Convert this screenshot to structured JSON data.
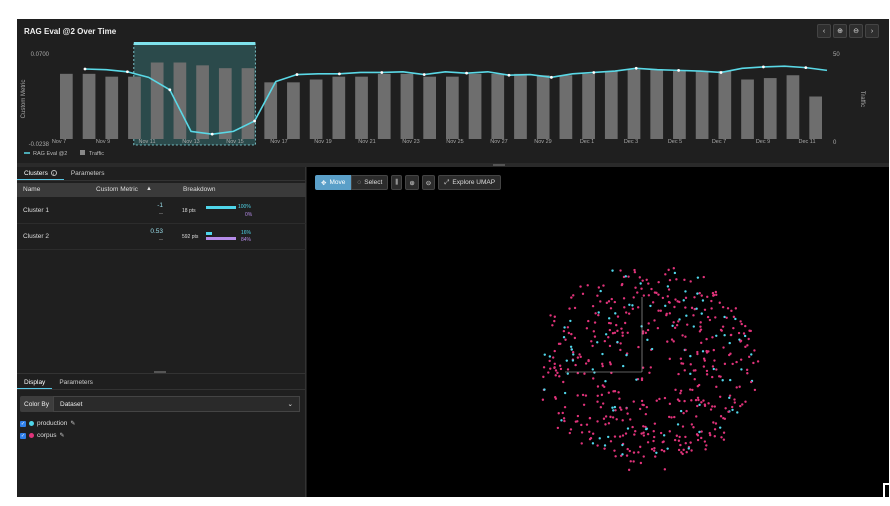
{
  "header": {
    "title": "RAG Eval @2 Over Time",
    "nav": [
      "‹",
      "⊕",
      "⊖",
      "›"
    ]
  },
  "chart_data": {
    "type": "bar",
    "title": "RAG Eval @2 Over Time",
    "ylabel": "Custom Metric",
    "y2label": "Traffic",
    "ytick_labels": [
      "0.0700",
      "-0.0238"
    ],
    "y2tick_labels": [
      "50",
      "0"
    ],
    "x_tick_labels": [
      "Nov 7",
      "Nov 9",
      "Nov 11",
      "Nov 13",
      "Nov 15",
      "Nov 17",
      "Nov 19",
      "Nov 21",
      "Nov 23",
      "Nov 25",
      "Nov 27",
      "Nov 29",
      "Dec 1",
      "Dec 3",
      "Dec 5",
      "Dec 7",
      "Dec 9",
      "Dec 11"
    ],
    "series": [
      {
        "name": "RAG Eval @2",
        "type": "line",
        "color": "#5ad8e6",
        "values": [
          0.07,
          0.069,
          0.066,
          0.058,
          0.04,
          -0.02,
          -0.024,
          -0.02,
          -0.005,
          0.052,
          0.062,
          0.063,
          0.063,
          0.065,
          0.065,
          0.066,
          0.062,
          0.066,
          0.064,
          0.066,
          0.061,
          0.062,
          0.058,
          0.063,
          0.065,
          0.067,
          0.071,
          0.069,
          0.068,
          0.067,
          0.065,
          0.071,
          0.073,
          0.074,
          0.072,
          0.068
        ]
      },
      {
        "name": "Traffic",
        "type": "bar",
        "color": "#6e6e6e",
        "values": [
          46,
          46,
          44,
          44,
          54,
          54,
          52,
          50,
          50,
          40,
          40,
          42,
          44,
          44,
          46,
          46,
          44,
          44,
          46,
          46,
          46,
          45,
          45,
          46,
          48,
          49,
          49,
          48,
          48,
          48,
          42,
          43,
          45,
          30
        ]
      }
    ],
    "selection_range": [
      "Nov 14",
      "Nov 18"
    ],
    "legend_position": "bottom-left",
    "grid": false
  },
  "clusters_panel": {
    "tabs": [
      "Clusters",
      "Parameters"
    ],
    "columns": [
      "Name",
      "Custom Metric",
      "Breakdown"
    ],
    "rows": [
      {
        "name": "Cluster 1",
        "metric": "-1",
        "metric_sub": "--",
        "pts": "18 pts",
        "prod_pct": "100%",
        "corpus_pct": "0%",
        "prod_frac": 1.0,
        "corpus_frac": 0.0
      },
      {
        "name": "Cluster 2",
        "metric": "0.53",
        "metric_sub": "--",
        "pts": "592 pts",
        "prod_pct": "16%",
        "corpus_pct": "84%",
        "prod_frac": 0.16,
        "corpus_frac": 0.84
      }
    ]
  },
  "display_panel": {
    "tabs": [
      "Display",
      "Parameters"
    ],
    "color_by_label": "Color By",
    "color_by_value": "Dataset",
    "datasets": [
      {
        "name": "production",
        "color": "#4fd6ea",
        "checked": true
      },
      {
        "name": "corpus",
        "color": "#e0337a",
        "checked": true
      }
    ]
  },
  "umap_toolbar": {
    "move": "Move",
    "select": "Select",
    "explore": "Explore UMAP"
  },
  "colors": {
    "production": "#4fd6ea",
    "corpus": "#e0337a",
    "accent": "#5ac8e6"
  }
}
